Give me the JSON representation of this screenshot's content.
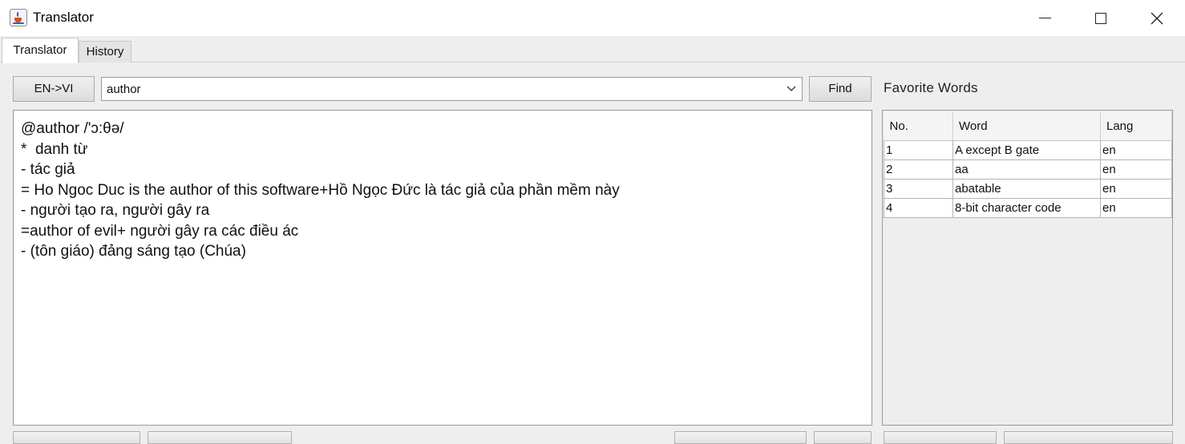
{
  "window": {
    "title": "Translator",
    "icon": "java-cup-icon",
    "controls": [
      "minimize-icon",
      "maximize-icon",
      "close-icon"
    ]
  },
  "tabs": [
    {
      "label": "Translator",
      "active": true
    },
    {
      "label": "History",
      "active": false
    }
  ],
  "toolbar": {
    "language_button": "EN->VI",
    "search_value": "author",
    "find_button": "Find"
  },
  "definition": {
    "lines": [
      "@author /'ɔ:θə/",
      "*  danh từ",
      "- tác giả",
      "= Ho Ngoc Duc is the author of this software+Hồ Ngọc Đức là tác giả của phần mềm này",
      "- người tạo ra, người gây ra",
      "=author of evil+ người gây ra các điều ác",
      "- (tôn giáo) đảng sáng tạo (Chúa)"
    ]
  },
  "favorites": {
    "title": "Favorite Words",
    "columns": [
      "No.",
      "Word",
      "Lang"
    ],
    "rows": [
      [
        "1",
        "A except B gate",
        "en"
      ],
      [
        "2",
        "aa",
        "en"
      ],
      [
        "3",
        "abatable",
        "en"
      ],
      [
        "4",
        "8-bit character code",
        "en"
      ]
    ]
  }
}
